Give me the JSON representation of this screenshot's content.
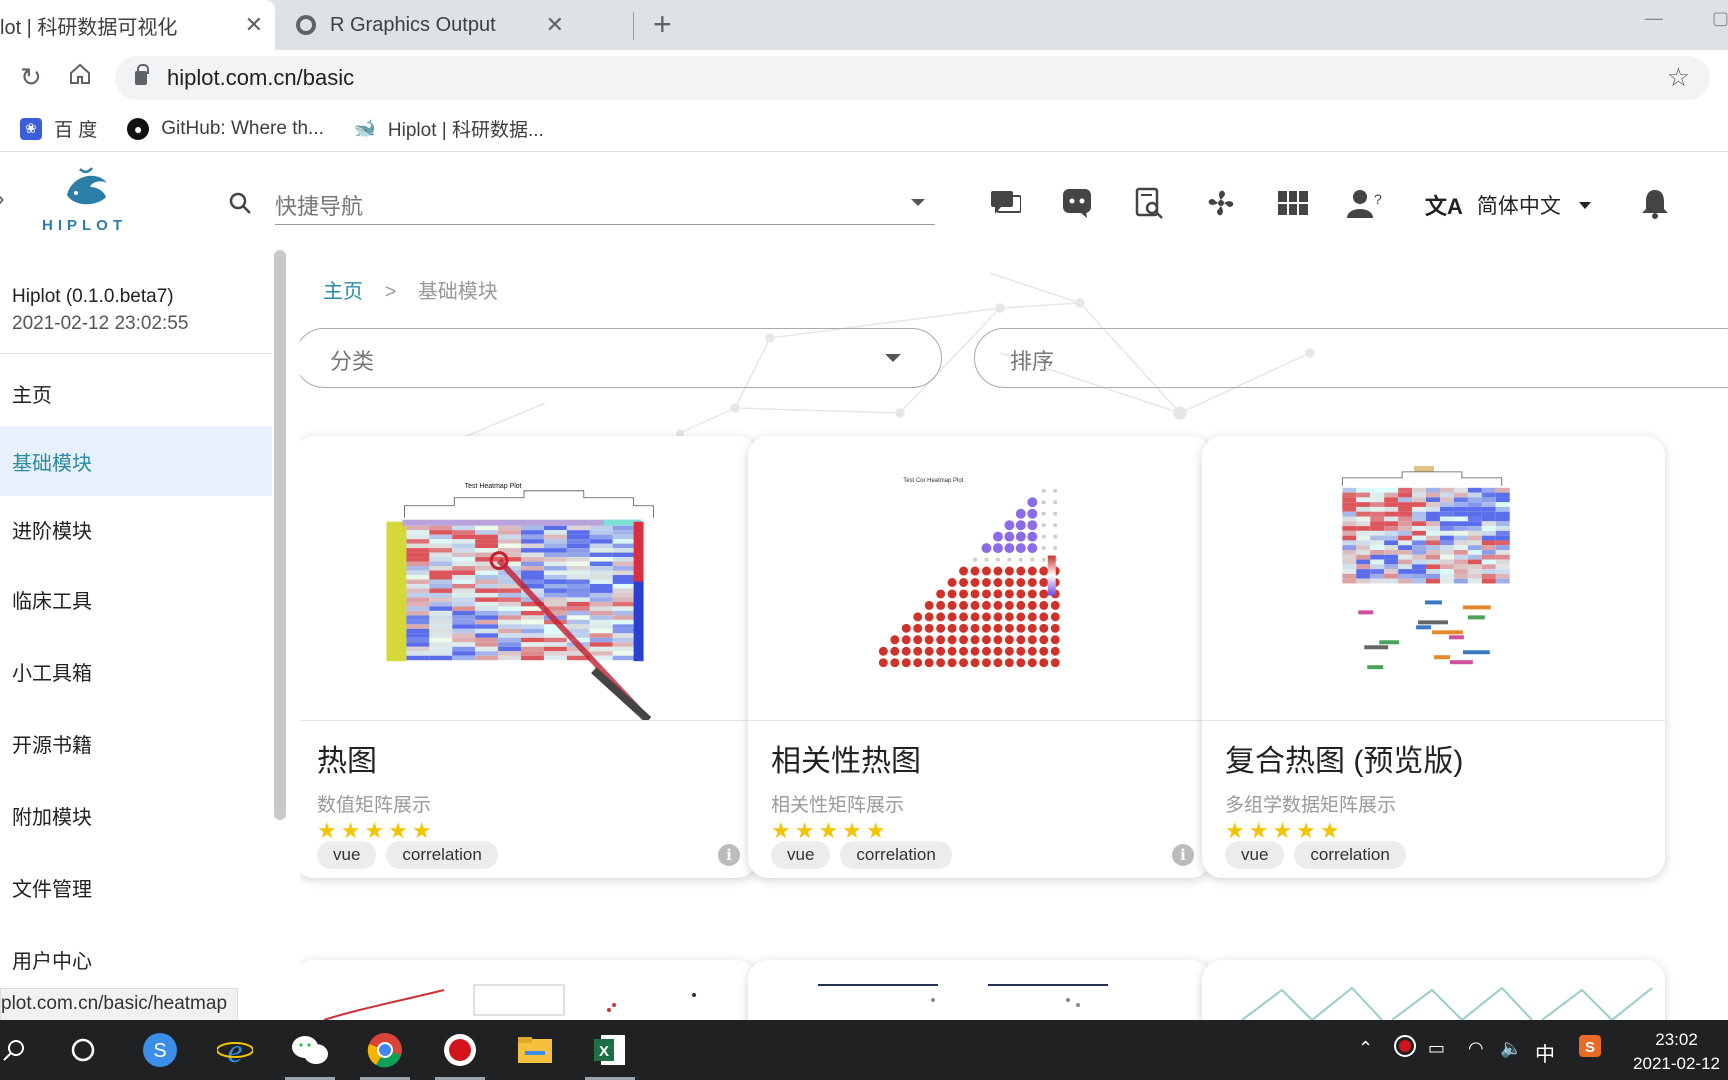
{
  "browser": {
    "tabs": [
      {
        "title": "lot | 科研数据可视化",
        "close": "✕"
      },
      {
        "title": "R Graphics Output",
        "close": "✕"
      }
    ],
    "new_tab": "+",
    "url": "hiplot.com.cn/basic",
    "bookmarks": [
      {
        "label": "百 度",
        "icon": "paw-icon"
      },
      {
        "label": "GitHub: Where th...",
        "icon": "github-icon"
      },
      {
        "label": "Hiplot | 科研数据...",
        "icon": "hiplot-icon"
      }
    ]
  },
  "header": {
    "logo_text": "HIPLOT",
    "search_placeholder": "快捷导航",
    "language": "简体中文",
    "icons": [
      "chat-icon",
      "discord-icon",
      "search-doc-icon",
      "fan-icon",
      "grid-icon",
      "help-user-icon",
      "bell-icon"
    ]
  },
  "sidebar": {
    "app_version": "Hiplot (0.1.0.beta7)",
    "build_time": "2021-02-12 23:02:55",
    "items": [
      {
        "label": "主页"
      },
      {
        "label": "基础模块"
      },
      {
        "label": "进阶模块"
      },
      {
        "label": "临床工具"
      },
      {
        "label": "小工具箱"
      },
      {
        "label": "开源书籍"
      },
      {
        "label": "附加模块"
      },
      {
        "label": "文件管理"
      },
      {
        "label": "用户中心"
      }
    ],
    "active_item": "基础模块"
  },
  "status_url": "plot.com.cn/basic/heatmap",
  "main": {
    "breadcrumb": {
      "home": "主页",
      "separator": ">",
      "current": "基础模块"
    },
    "filter_category_placeholder": "分类",
    "filter_sort_placeholder": "排序",
    "cards": [
      {
        "title": "热图",
        "description": "数值矩阵展示",
        "stars": "★★★★★",
        "rating": 5,
        "tags": [
          "vue",
          "correlation"
        ],
        "thumb_title": "Test Heatmap Plot"
      },
      {
        "title": "相关性热图",
        "description": "相关性矩阵展示",
        "stars": "★★★★★",
        "rating": 5,
        "tags": [
          "vue",
          "correlation"
        ],
        "thumb_title": "Test Cor Heatmap Plot"
      },
      {
        "title": "复合热图 (预览版)",
        "description": "多组学数据矩阵展示",
        "stars": "★★★★★",
        "rating": 5,
        "tags": [
          "vue",
          "correlation"
        ],
        "thumb_title": ""
      }
    ]
  },
  "taskbar": {
    "time": "23:02",
    "date": "2021-02-12",
    "ime": "中",
    "apps": [
      "search-icon",
      "cortana-icon",
      "sogou-browser-icon",
      "ie-icon",
      "wechat-icon",
      "chrome-icon",
      "recorder-icon",
      "file-explorer-icon",
      "excel-icon"
    ]
  }
}
